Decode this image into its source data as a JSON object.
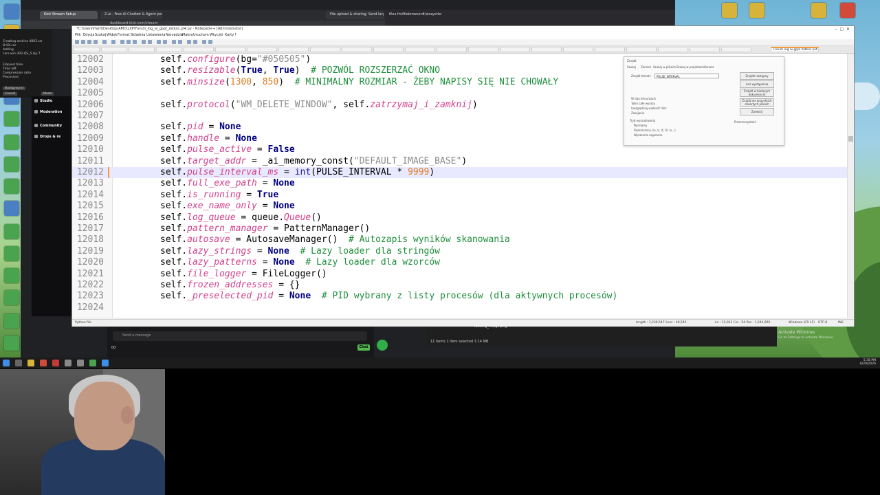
{
  "browser": {
    "tabs": [
      "Kick Stream Setup",
      "Z.ai - Free AI Chatbot & Agent powe",
      "File upload & sharing. Send large",
      "files.fm/filebrowser#/wszystko"
    ],
    "address": "dashboard.kick.com/stream",
    "file_browser_title": "files.fm/filebrowser#/wszystko"
  },
  "side_panel": {
    "lines": [
      "Creating archive 4003.rar",
      "D:\\D\\.rar",
      "Adding",
      "cars-win-303-QS_5.zip.7",
      "Elapsed time",
      "Time left",
      "Compression ratio",
      "Processed"
    ],
    "buttons": [
      "Background",
      "Cancel",
      "Mode"
    ]
  },
  "left_nav": {
    "items": [
      "Studio",
      "Moderation",
      "Community",
      "Drops & re"
    ]
  },
  "chat": {
    "placeholder": "Send a message",
    "count": "00",
    "chat_button": "Chat"
  },
  "explorer": {
    "status": "11 items   1 item selected  3.14 MB",
    "row": "loading_image.png"
  },
  "notepad": {
    "title": "*C:\\Users\\Hartl\\Desktop\\AMD\\LXP\\Forum_log_ai_gppl_zetknc.pl4.py - Notepad++ [Administrator]",
    "menu": [
      "Plik",
      "Edycja",
      "Szukaj",
      "Widok",
      "Format",
      "Składnia",
      "Ustawienia",
      "Narzędzia",
      "Makra",
      "Uruchom",
      "Wtyczki",
      "Karty",
      "?"
    ],
    "active_tab": "Forum log ai gppl zetknc.pl4.py",
    "lines": [
      {
        "n": "12002",
        "segs": [
          [
            "fn",
            "self."
          ],
          [
            "attr",
            "configure"
          ],
          [
            "fn",
            "(bg="
          ],
          [
            "str",
            "\"#050505\""
          ],
          [
            "fn",
            ")"
          ]
        ]
      },
      {
        "n": "12003",
        "segs": [
          [
            "fn",
            "self."
          ],
          [
            "attr",
            "resizable"
          ],
          [
            "fn",
            "("
          ],
          [
            "bold",
            "True"
          ],
          [
            "fn",
            ", "
          ],
          [
            "bold",
            "True"
          ],
          [
            "fn",
            ")  "
          ],
          [
            "cmt",
            "# POZWÓL ROZSZERZAĆ OKNO"
          ]
        ]
      },
      {
        "n": "12004",
        "segs": [
          [
            "fn",
            "self."
          ],
          [
            "attr",
            "minsize"
          ],
          [
            "fn",
            "("
          ],
          [
            "num",
            "1300"
          ],
          [
            "fn",
            ", "
          ],
          [
            "num",
            "850"
          ],
          [
            "fn",
            ")  "
          ],
          [
            "cmt",
            "# MINIMALNY ROZMIAR - ŻEBY NAPISY SIĘ NIE CHOWAŁY"
          ]
        ]
      },
      {
        "n": "12005",
        "segs": []
      },
      {
        "n": "12006",
        "segs": [
          [
            "fn",
            "self."
          ],
          [
            "attr",
            "protocol"
          ],
          [
            "fn",
            "("
          ],
          [
            "str",
            "\"WM_DELETE_WINDOW\""
          ],
          [
            "fn",
            ", self."
          ],
          [
            "attr",
            "zatrzymaj_i_zamknij"
          ],
          [
            "fn",
            ")"
          ]
        ]
      },
      {
        "n": "12007",
        "segs": []
      },
      {
        "n": "12008",
        "segs": [
          [
            "fn",
            "self."
          ],
          [
            "attr",
            "pid"
          ],
          [
            "fn",
            " = "
          ],
          [
            "bold",
            "None"
          ]
        ]
      },
      {
        "n": "12009",
        "segs": [
          [
            "fn",
            "self."
          ],
          [
            "attr",
            "handle"
          ],
          [
            "fn",
            " = "
          ],
          [
            "bold",
            "None"
          ]
        ]
      },
      {
        "n": "12010",
        "segs": [
          [
            "fn",
            "self."
          ],
          [
            "attr",
            "pulse_active"
          ],
          [
            "fn",
            " = "
          ],
          [
            "bold",
            "False"
          ]
        ]
      },
      {
        "n": "12011",
        "segs": [
          [
            "fn",
            "self."
          ],
          [
            "attr",
            "target_addr"
          ],
          [
            "fn",
            " = _ai_memory_const("
          ],
          [
            "str",
            "\"DEFAULT_IMAGE_BASE\""
          ],
          [
            "fn",
            ")"
          ]
        ]
      },
      {
        "n": "12012",
        "segs": [
          [
            "fn",
            "self."
          ],
          [
            "attr",
            "pulse_interval_ms"
          ],
          [
            "fn",
            " = "
          ],
          [
            "kw",
            "int"
          ],
          [
            "fn",
            "(PULSE_INTERVAL * "
          ],
          [
            "num",
            "9999"
          ],
          [
            "fn",
            ")"
          ]
        ]
      },
      {
        "n": "12013",
        "segs": [
          [
            "fn",
            "self."
          ],
          [
            "attr",
            "full_exe_path"
          ],
          [
            "fn",
            " = "
          ],
          [
            "bold",
            "None"
          ]
        ]
      },
      {
        "n": "12014",
        "segs": [
          [
            "fn",
            "self."
          ],
          [
            "attr",
            "is_running"
          ],
          [
            "fn",
            " = "
          ],
          [
            "bold",
            "True"
          ]
        ]
      },
      {
        "n": "12015",
        "segs": [
          [
            "fn",
            "self."
          ],
          [
            "attr",
            "exe_name_only"
          ],
          [
            "fn",
            " = "
          ],
          [
            "bold",
            "None"
          ]
        ]
      },
      {
        "n": "12016",
        "segs": [
          [
            "fn",
            "self."
          ],
          [
            "attr",
            "log_queue"
          ],
          [
            "fn",
            " = queue."
          ],
          [
            "attr",
            "Queue"
          ],
          [
            "fn",
            "()"
          ]
        ]
      },
      {
        "n": "12017",
        "segs": [
          [
            "fn",
            "self."
          ],
          [
            "attr",
            "pattern_manager"
          ],
          [
            "fn",
            " = PatternManager()"
          ]
        ]
      },
      {
        "n": "12018",
        "segs": [
          [
            "fn",
            "self."
          ],
          [
            "attr",
            "autosave"
          ],
          [
            "fn",
            " = AutosaveManager()  "
          ],
          [
            "cmt",
            "# Autozapis wyników skanowania"
          ]
        ]
      },
      {
        "n": "12019",
        "segs": [
          [
            "fn",
            "self."
          ],
          [
            "attr",
            "lazy_strings"
          ],
          [
            "fn",
            " = "
          ],
          [
            "bold",
            "None"
          ],
          [
            "fn",
            "  "
          ],
          [
            "cmt",
            "# Lazy loader dla stringów"
          ]
        ]
      },
      {
        "n": "12020",
        "segs": [
          [
            "fn",
            "self."
          ],
          [
            "attr",
            "lazy_patterns"
          ],
          [
            "fn",
            " = "
          ],
          [
            "bold",
            "None"
          ],
          [
            "fn",
            "  "
          ],
          [
            "cmt",
            "# Lazy loader dla wzorców"
          ]
        ]
      },
      {
        "n": "12021",
        "segs": [
          [
            "fn",
            "self."
          ],
          [
            "attr",
            "file_logger"
          ],
          [
            "fn",
            " = FileLogger()"
          ]
        ]
      },
      {
        "n": "12022",
        "segs": [
          [
            "fn",
            "self."
          ],
          [
            "attr",
            "frozen_addresses"
          ],
          [
            "fn",
            " = {}"
          ]
        ]
      },
      {
        "n": "12023",
        "segs": [
          [
            "fn",
            "self."
          ],
          [
            "attr",
            "_preselected_pid"
          ],
          [
            "fn",
            " = "
          ],
          [
            "bold",
            "None"
          ],
          [
            "fn",
            "  "
          ],
          [
            "cmt",
            "# PID wybrany z listy procesów (dla aktywnych procesów)"
          ]
        ]
      },
      {
        "n": "12024",
        "segs": []
      }
    ],
    "current_line_index": 10,
    "status": {
      "lang": "Python file",
      "length": "length : 1,239,547    lines : 48,545",
      "pos": "Ln : 12,012    Col : 54    Pos : 1,244,992",
      "eol": "Windows (CR LF)",
      "enc": "UTF-8",
      "ins": "INS"
    }
  },
  "find_dialog": {
    "title": "Znajdź",
    "tabs": [
      "Szukaj",
      "Zamień",
      "Szukaj w plikach",
      "Szukaj w projektach",
      "Oznacz"
    ],
    "find_label": "Znajdź (tekst):",
    "find_value": "PULSE_INTERVAL",
    "buttons": [
      "Znajdź następny",
      "Licz wystąpienia",
      "Znajdź w bieżącym dokumencie",
      "Znajdź we wszystkich otwartych plikach",
      "Zamknij"
    ],
    "options": [
      "W obu kierunkach",
      "Tylko całe wyrazy",
      "Uwzględniaj wielkość liter",
      "Zawijanie"
    ],
    "mode_label": "Tryb wyszukiwania",
    "modes": [
      "Normalny",
      "Rozszerzony (\\n, \\r, \\t, \\0, \\x...)",
      "Wyrażenia regularne"
    ],
    "transparency": "Przezroczystość"
  },
  "taskbar": {
    "time": "5:38 PM",
    "date": "6/29/2026"
  },
  "watermark": {
    "line1": "Activate Windows",
    "line2": "Go to Settings to activate Windows."
  }
}
